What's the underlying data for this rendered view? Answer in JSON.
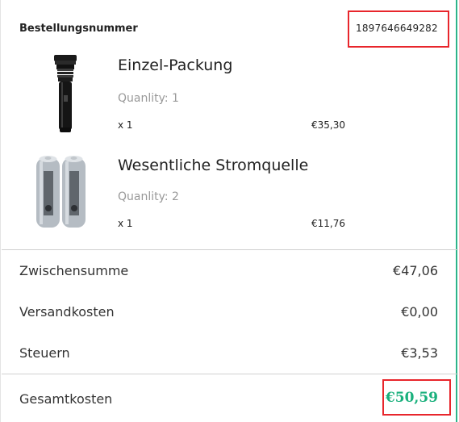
{
  "order": {
    "label": "Bestellungsnummer",
    "number": "1897646649282"
  },
  "products": [
    {
      "title": "Einzel-Packung",
      "quantity_text": "Quanlity: 1",
      "multiplier": "x 1",
      "price": "€35,30",
      "icon": "flashlight-image"
    },
    {
      "title": "Wesentliche Stromquelle",
      "quantity_text": "Quanlity: 2",
      "multiplier": "x 1",
      "price": "€11,76",
      "icon": "battery-image"
    }
  ],
  "summary": {
    "subtotal_label": "Zwischensumme",
    "subtotal_value": "€47,06",
    "shipping_label": "Versandkosten",
    "shipping_value": "€0,00",
    "tax_label": "Steuern",
    "tax_value": "€3,53",
    "total_label": "Gesamtkosten",
    "total_value": "€50,59"
  },
  "colors": {
    "accent_green": "#19b07c",
    "highlight_red": "#e8262c",
    "frame_green": "#2db48a"
  }
}
